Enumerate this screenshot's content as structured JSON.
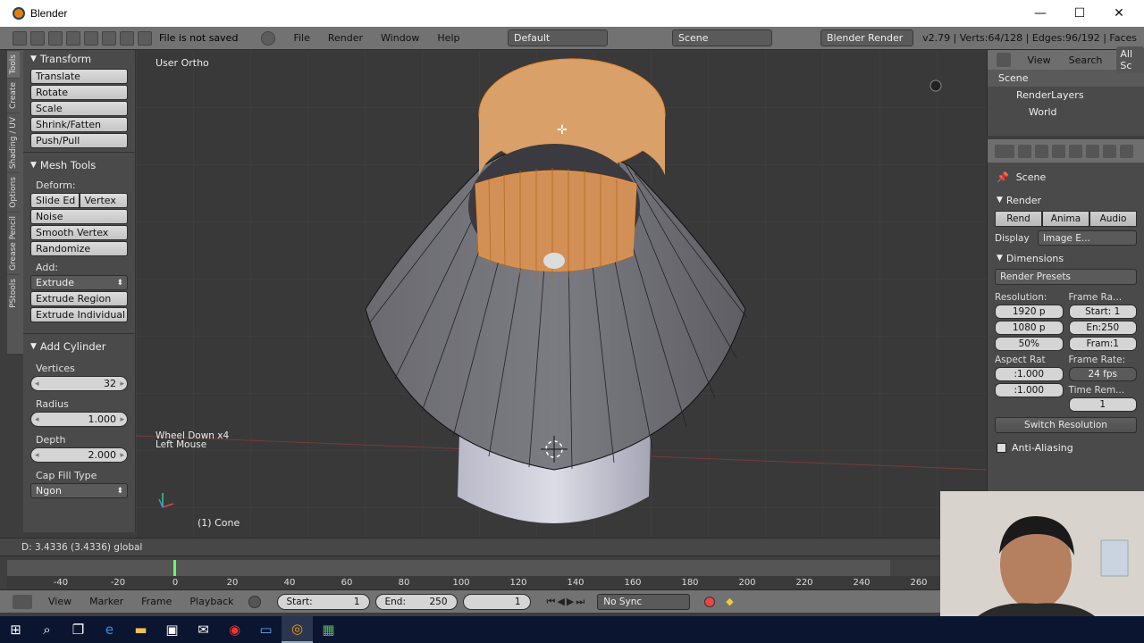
{
  "window": {
    "title": "Blender",
    "minimize": "—",
    "maximize": "☐",
    "close": "✕"
  },
  "infobar": {
    "file_status": "File is not saved",
    "menus": [
      "File",
      "Render",
      "Window",
      "Help"
    ],
    "layout": "Default",
    "scene": "Scene",
    "engine": "Blender Render",
    "stats": "v2.79 | Verts:64/128 | Edges:96/192 | Faces"
  },
  "tool_tabs": [
    "Tools",
    "Create",
    "Shading / UV",
    "Options",
    "Grease Pencil",
    "PStools"
  ],
  "toolshelf": {
    "transform_title": "Transform",
    "transform_buttons": [
      "Translate",
      "Rotate",
      "Scale",
      "Shrink/Fatten",
      "Push/Pull"
    ],
    "mesh_tools_title": "Mesh Tools",
    "deform_label": "Deform:",
    "slide_edge": "Slide Ed",
    "vertex": "Vertex",
    "noise": "Noise",
    "smooth_vertex": "Smooth Vertex",
    "randomize": "Randomize",
    "add_label": "Add:",
    "extrude": "Extrude",
    "extrude_region": "Extrude Region",
    "extrude_individual": "Extrude Individual"
  },
  "operator_panel": {
    "title": "Add Cylinder",
    "vertices_label": "Vertices",
    "vertices_value": "32",
    "radius_label": "Radius",
    "radius_value": "1.000",
    "depth_label": "Depth",
    "depth_value": "2.000",
    "cap_fill_label": "Cap Fill Type",
    "cap_fill_value": "Ngon"
  },
  "viewport": {
    "view_name": "User Ortho",
    "last_ops_line1": "Wheel Down x4",
    "last_ops_line2": "Left Mouse",
    "object_name": "(1) Cone",
    "status": "D: 3.4336 (3.4336) global"
  },
  "outliner": {
    "view": "View",
    "search": "Search",
    "all_scenes": "All Sc",
    "items": [
      "Scene",
      "RenderLayers",
      "World"
    ]
  },
  "properties": {
    "context": "Scene",
    "render_title": "Render",
    "render_buttons": [
      "Rend",
      "Anima",
      "Audio"
    ],
    "display_label": "Display",
    "display_value": "Image E...",
    "dimensions_title": "Dimensions",
    "render_presets": "Render Presets",
    "resolution_label": "Resolution:",
    "frame_range_label": "Frame Ra...",
    "res_x": "1920 p",
    "res_y": "1080 p",
    "res_pct": "50%",
    "start": "Start: 1",
    "end": "En:250",
    "frame": "Fram:1",
    "aspect_label": "Aspect Rat",
    "frame_rate_label": "Frame Rate:",
    "aspect_x": ":1.000",
    "aspect_y": ":1.000",
    "fps": "24 fps",
    "time_remap": "Time Rem...",
    "time_val": "1",
    "switch_resolution": "Switch Resolution",
    "anti_aliasing": "Anti-Aliasing"
  },
  "timeline": {
    "ticks": [
      "-40",
      "-20",
      "0",
      "20",
      "40",
      "60",
      "80",
      "100",
      "120",
      "140",
      "160",
      "180",
      "200",
      "220",
      "240",
      "260"
    ],
    "menus": [
      "View",
      "Marker",
      "Frame",
      "Playback"
    ],
    "start_label": "Start:",
    "start_value": "1",
    "end_label": "End:",
    "end_value": "250",
    "current": "1",
    "sync": "No Sync"
  },
  "colors": {
    "accent_orange": "#e8a060",
    "selected_face": "#d9a06a",
    "viewport_bg": "#393939"
  }
}
